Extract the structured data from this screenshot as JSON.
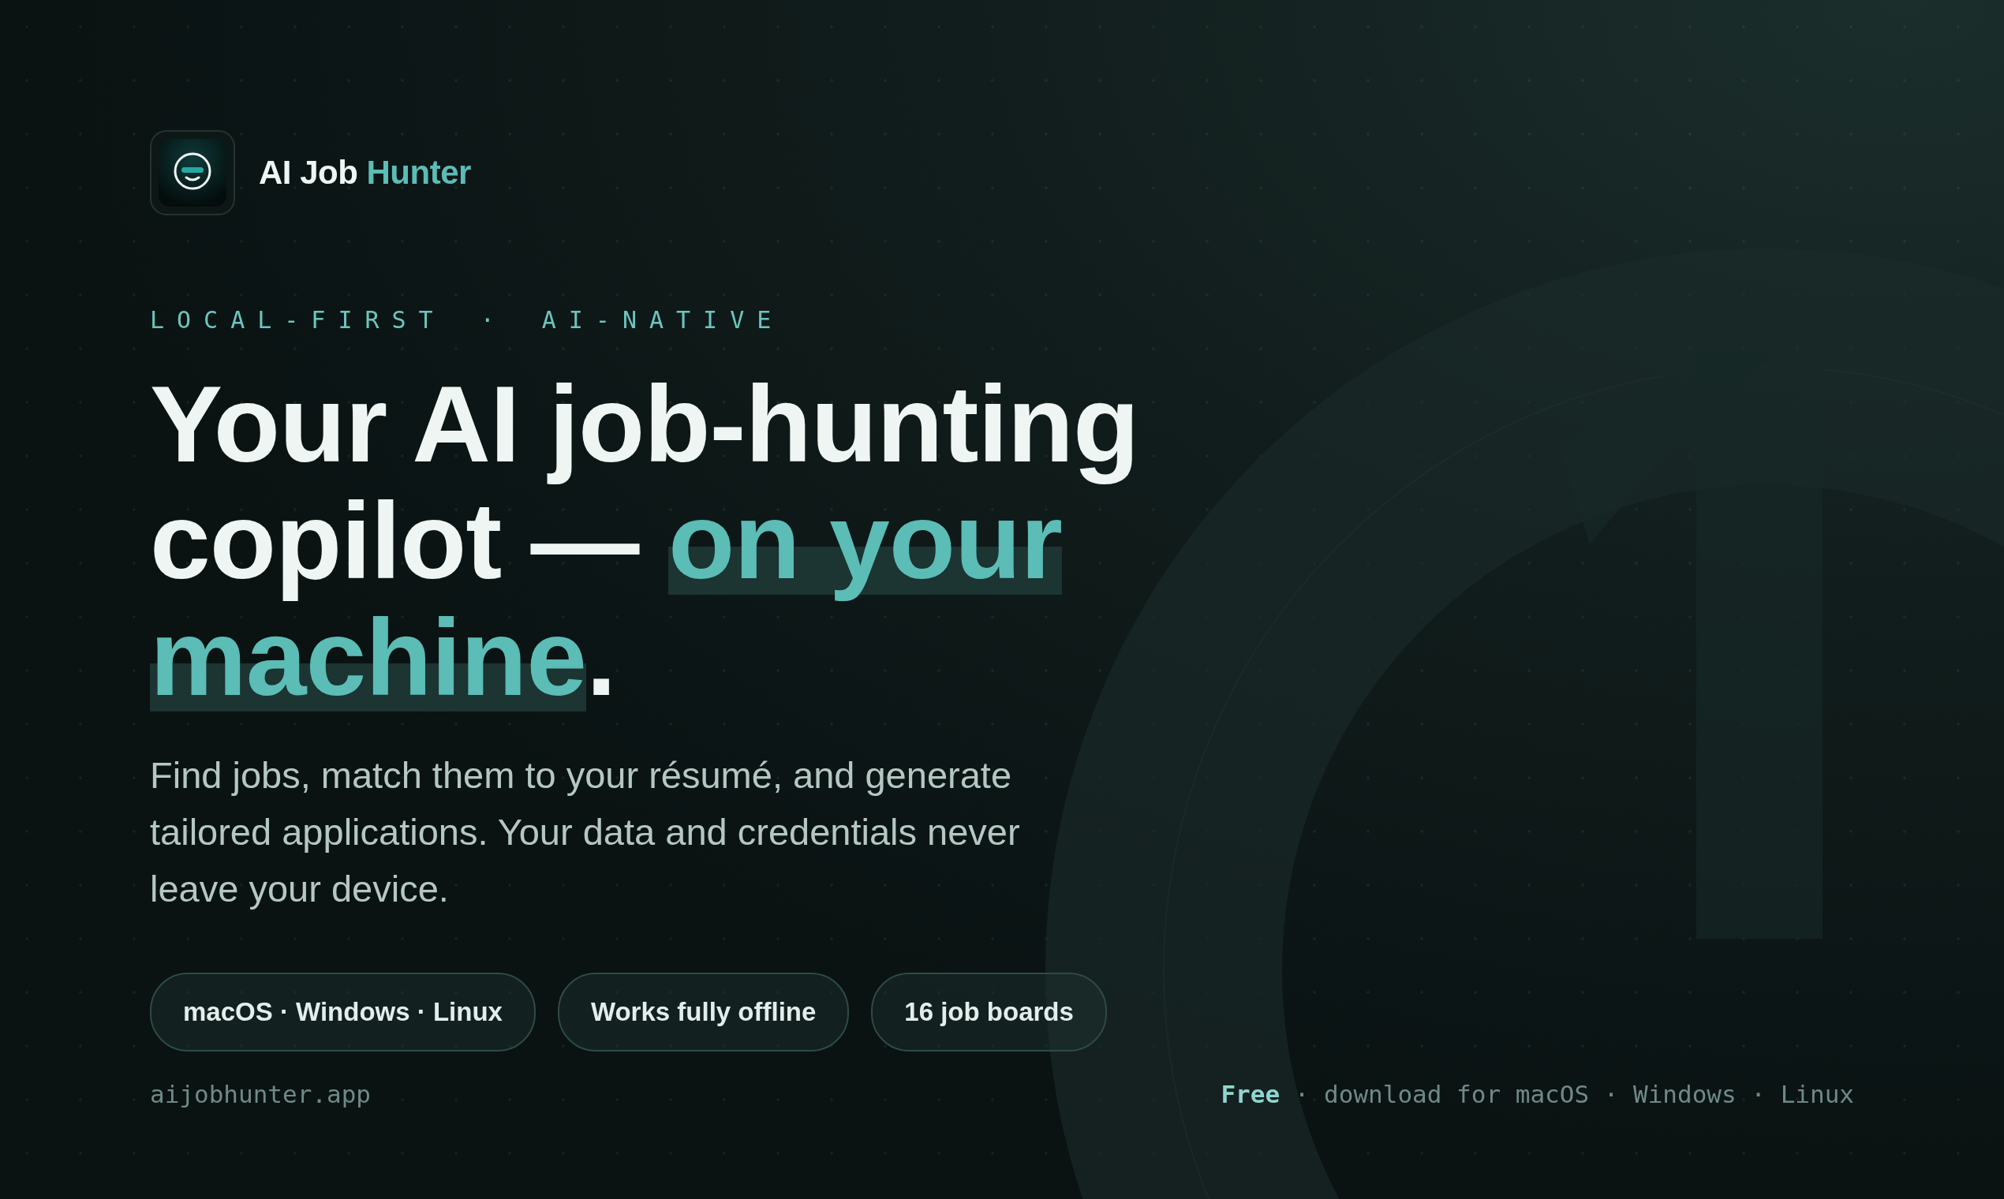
{
  "brand": {
    "name": "AI Job",
    "accent": "Hunter"
  },
  "eyebrow": {
    "items": [
      "LOCAL-FIRST",
      "AI-NATIVE"
    ],
    "separator": "·"
  },
  "headline": {
    "before": "Your AI job-hunting copilot — ",
    "highlight": "on your machine",
    "after": "."
  },
  "lead": "Find jobs, match them to your résumé, and generate tailored applications. Your data and credentials never leave your device.",
  "pills": [
    "macOS · Windows · Linux",
    "Works fully offline",
    "16 job boards"
  ],
  "footer": {
    "url": "aijobhunter.app",
    "download": "**Free** · download for macOS · Windows · Linux"
  }
}
